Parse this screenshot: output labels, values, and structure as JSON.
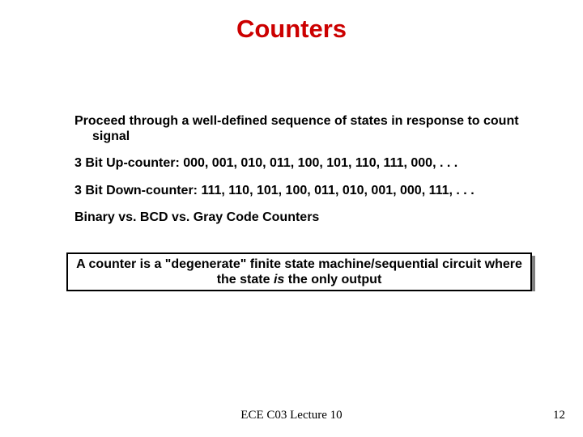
{
  "title": "Counters",
  "body": {
    "p1": "Proceed through a well-defined sequence of states in response to count signal",
    "p2": "3 Bit Up-counter: 000, 001, 010, 011, 100, 101, 110, 111, 000, . . .",
    "p3": "3 Bit Down-counter:  111, 110, 101, 100, 011, 010, 001, 000, 111, . . .",
    "p4": "Binary vs. BCD vs. Gray Code Counters"
  },
  "box": {
    "pre": "A counter is a \"degenerate\" finite state machine/sequential circuit where the state ",
    "is": "is",
    "post": " the only output"
  },
  "footer": {
    "center": "ECE C03 Lecture 10",
    "page": "12"
  }
}
